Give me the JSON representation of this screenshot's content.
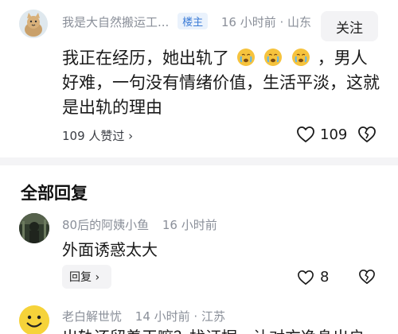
{
  "post": {
    "author": "我是大自然搬运工...",
    "author_tag": "楼主",
    "time_location": "16 小时前 · 山东",
    "follow_label": "关注",
    "text_before": "我正在经历，她出轨了",
    "text_after": "，男人好难，一句没有情绪价值，生活平淡，这就是出轨的理由",
    "emoji_count": 3,
    "likes_text": "109 人赞过 ›",
    "like_count": "109",
    "icons": [
      "speech-bubble-icon",
      "heart-icon",
      "chevron-right-icon"
    ]
  },
  "comments_section_title": "全部回复",
  "comments": [
    {
      "author": "80后的阿姨小鱼",
      "time": "16 小时前",
      "text": "外面诱惑太大",
      "reply_label": "回复 ›",
      "like_count": "8"
    },
    {
      "author": "老白解世忧",
      "time_location": "14 小时前 · 江苏",
      "text": "出轨还留着干嘛？找证据，让对方净身出户"
    }
  ]
}
